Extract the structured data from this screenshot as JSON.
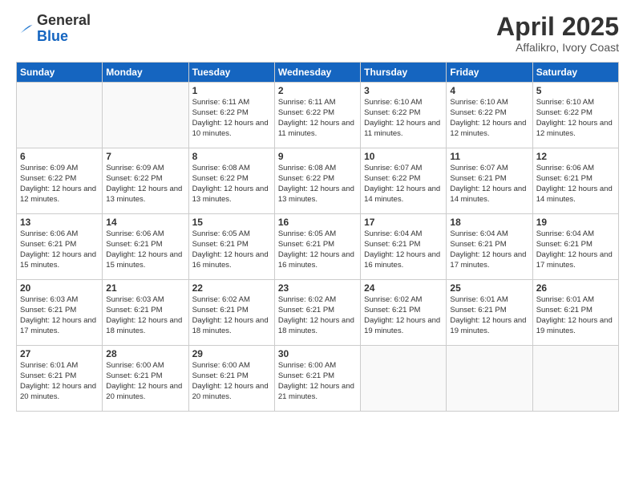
{
  "logo": {
    "general": "General",
    "blue": "Blue"
  },
  "title": "April 2025",
  "subtitle": "Affalikro, Ivory Coast",
  "days_of_week": [
    "Sunday",
    "Monday",
    "Tuesday",
    "Wednesday",
    "Thursday",
    "Friday",
    "Saturday"
  ],
  "weeks": [
    [
      {
        "day": "",
        "info": ""
      },
      {
        "day": "",
        "info": ""
      },
      {
        "day": "1",
        "info": "Sunrise: 6:11 AM\nSunset: 6:22 PM\nDaylight: 12 hours and 10 minutes."
      },
      {
        "day": "2",
        "info": "Sunrise: 6:11 AM\nSunset: 6:22 PM\nDaylight: 12 hours and 11 minutes."
      },
      {
        "day": "3",
        "info": "Sunrise: 6:10 AM\nSunset: 6:22 PM\nDaylight: 12 hours and 11 minutes."
      },
      {
        "day": "4",
        "info": "Sunrise: 6:10 AM\nSunset: 6:22 PM\nDaylight: 12 hours and 12 minutes."
      },
      {
        "day": "5",
        "info": "Sunrise: 6:10 AM\nSunset: 6:22 PM\nDaylight: 12 hours and 12 minutes."
      }
    ],
    [
      {
        "day": "6",
        "info": "Sunrise: 6:09 AM\nSunset: 6:22 PM\nDaylight: 12 hours and 12 minutes."
      },
      {
        "day": "7",
        "info": "Sunrise: 6:09 AM\nSunset: 6:22 PM\nDaylight: 12 hours and 13 minutes."
      },
      {
        "day": "8",
        "info": "Sunrise: 6:08 AM\nSunset: 6:22 PM\nDaylight: 12 hours and 13 minutes."
      },
      {
        "day": "9",
        "info": "Sunrise: 6:08 AM\nSunset: 6:22 PM\nDaylight: 12 hours and 13 minutes."
      },
      {
        "day": "10",
        "info": "Sunrise: 6:07 AM\nSunset: 6:22 PM\nDaylight: 12 hours and 14 minutes."
      },
      {
        "day": "11",
        "info": "Sunrise: 6:07 AM\nSunset: 6:21 PM\nDaylight: 12 hours and 14 minutes."
      },
      {
        "day": "12",
        "info": "Sunrise: 6:06 AM\nSunset: 6:21 PM\nDaylight: 12 hours and 14 minutes."
      }
    ],
    [
      {
        "day": "13",
        "info": "Sunrise: 6:06 AM\nSunset: 6:21 PM\nDaylight: 12 hours and 15 minutes."
      },
      {
        "day": "14",
        "info": "Sunrise: 6:06 AM\nSunset: 6:21 PM\nDaylight: 12 hours and 15 minutes."
      },
      {
        "day": "15",
        "info": "Sunrise: 6:05 AM\nSunset: 6:21 PM\nDaylight: 12 hours and 16 minutes."
      },
      {
        "day": "16",
        "info": "Sunrise: 6:05 AM\nSunset: 6:21 PM\nDaylight: 12 hours and 16 minutes."
      },
      {
        "day": "17",
        "info": "Sunrise: 6:04 AM\nSunset: 6:21 PM\nDaylight: 12 hours and 16 minutes."
      },
      {
        "day": "18",
        "info": "Sunrise: 6:04 AM\nSunset: 6:21 PM\nDaylight: 12 hours and 17 minutes."
      },
      {
        "day": "19",
        "info": "Sunrise: 6:04 AM\nSunset: 6:21 PM\nDaylight: 12 hours and 17 minutes."
      }
    ],
    [
      {
        "day": "20",
        "info": "Sunrise: 6:03 AM\nSunset: 6:21 PM\nDaylight: 12 hours and 17 minutes."
      },
      {
        "day": "21",
        "info": "Sunrise: 6:03 AM\nSunset: 6:21 PM\nDaylight: 12 hours and 18 minutes."
      },
      {
        "day": "22",
        "info": "Sunrise: 6:02 AM\nSunset: 6:21 PM\nDaylight: 12 hours and 18 minutes."
      },
      {
        "day": "23",
        "info": "Sunrise: 6:02 AM\nSunset: 6:21 PM\nDaylight: 12 hours and 18 minutes."
      },
      {
        "day": "24",
        "info": "Sunrise: 6:02 AM\nSunset: 6:21 PM\nDaylight: 12 hours and 19 minutes."
      },
      {
        "day": "25",
        "info": "Sunrise: 6:01 AM\nSunset: 6:21 PM\nDaylight: 12 hours and 19 minutes."
      },
      {
        "day": "26",
        "info": "Sunrise: 6:01 AM\nSunset: 6:21 PM\nDaylight: 12 hours and 19 minutes."
      }
    ],
    [
      {
        "day": "27",
        "info": "Sunrise: 6:01 AM\nSunset: 6:21 PM\nDaylight: 12 hours and 20 minutes."
      },
      {
        "day": "28",
        "info": "Sunrise: 6:00 AM\nSunset: 6:21 PM\nDaylight: 12 hours and 20 minutes."
      },
      {
        "day": "29",
        "info": "Sunrise: 6:00 AM\nSunset: 6:21 PM\nDaylight: 12 hours and 20 minutes."
      },
      {
        "day": "30",
        "info": "Sunrise: 6:00 AM\nSunset: 6:21 PM\nDaylight: 12 hours and 21 minutes."
      },
      {
        "day": "",
        "info": ""
      },
      {
        "day": "",
        "info": ""
      },
      {
        "day": "",
        "info": ""
      }
    ]
  ]
}
